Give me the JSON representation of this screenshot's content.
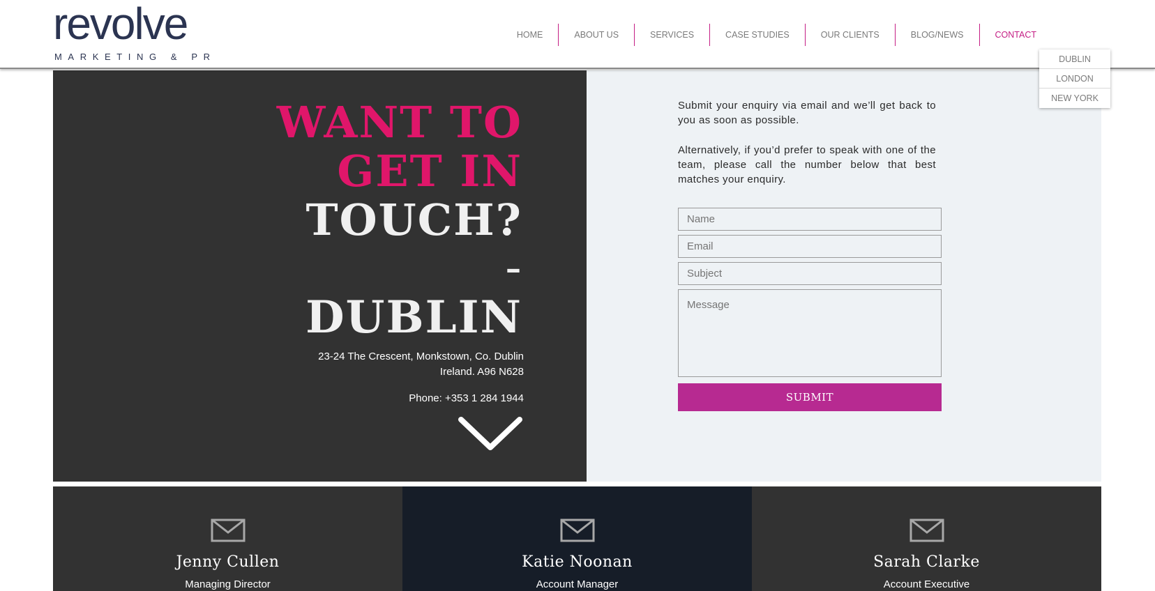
{
  "brand": {
    "logo_word": "revolve",
    "logo_tagline": "MARKETING & PR",
    "accent_color": "#c41d84"
  },
  "nav": {
    "items": [
      "HOME",
      "ABOUT US",
      "SERVICES",
      "CASE STUDIES",
      "OUR CLIENTS",
      "BLOG/NEWS",
      "CONTACT"
    ],
    "active": "CONTACT",
    "contact_dropdown": [
      "DUBLIN",
      "LONDON",
      "NEW YORK"
    ]
  },
  "hero": {
    "headline_line1": "WANT TO",
    "headline_line2": "GET IN",
    "headline_line3": "TOUCH?",
    "headline_dash": "–",
    "city": "DUBLIN",
    "address_line1": "23-24 The Crescent, Monkstown, Co. Dublin",
    "address_line2": "Ireland. A96 N628",
    "phone": "Phone: +353 1 284 1944",
    "scroll_icon": "chevron-down-icon"
  },
  "form": {
    "intro_1": "Submit your enquiry via email and we’ll get back to you as soon as possible.",
    "intro_2": "Alternatively, if you’d prefer to speak with one of the team, please call the number below that best matches your enquiry.",
    "name_placeholder": "Name",
    "email_placeholder": "Email",
    "subject_placeholder": "Subject",
    "message_placeholder": "Message",
    "submit_label": "SUBMIT",
    "submit_color": "#b72a91"
  },
  "team": [
    {
      "name": "Jenny Cullen",
      "role": "Managing Director",
      "icon": "envelope-icon"
    },
    {
      "name": "Katie Noonan",
      "role": "Account Manager",
      "icon": "envelope-icon"
    },
    {
      "name": "Sarah Clarke",
      "role": "Account Executive",
      "icon": "envelope-icon"
    }
  ]
}
